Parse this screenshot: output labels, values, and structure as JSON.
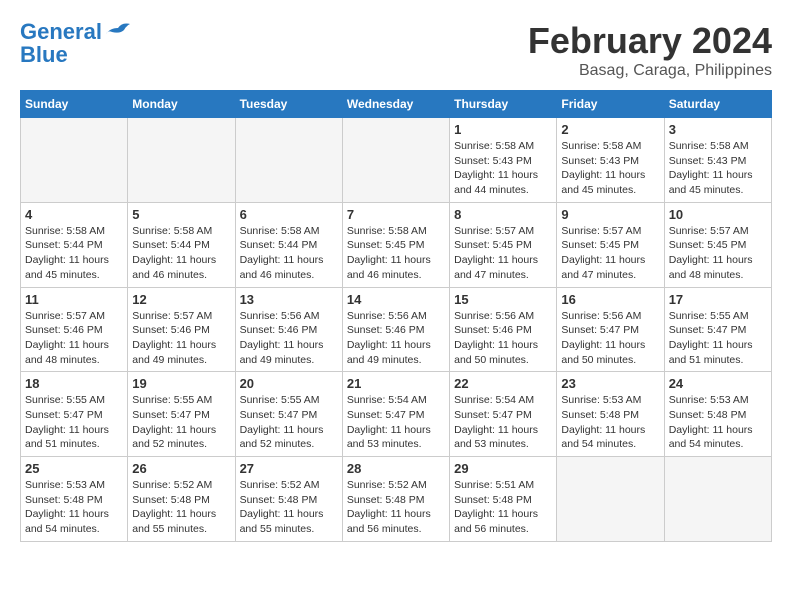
{
  "header": {
    "logo_line1": "General",
    "logo_line2": "Blue",
    "month_title": "February 2024",
    "location": "Basag, Caraga, Philippines"
  },
  "days_of_week": [
    "Sunday",
    "Monday",
    "Tuesday",
    "Wednesday",
    "Thursday",
    "Friday",
    "Saturday"
  ],
  "weeks": [
    [
      {
        "day": "",
        "info": ""
      },
      {
        "day": "",
        "info": ""
      },
      {
        "day": "",
        "info": ""
      },
      {
        "day": "",
        "info": ""
      },
      {
        "day": "1",
        "info": "Sunrise: 5:58 AM\nSunset: 5:43 PM\nDaylight: 11 hours\nand 44 minutes."
      },
      {
        "day": "2",
        "info": "Sunrise: 5:58 AM\nSunset: 5:43 PM\nDaylight: 11 hours\nand 45 minutes."
      },
      {
        "day": "3",
        "info": "Sunrise: 5:58 AM\nSunset: 5:43 PM\nDaylight: 11 hours\nand 45 minutes."
      }
    ],
    [
      {
        "day": "4",
        "info": "Sunrise: 5:58 AM\nSunset: 5:44 PM\nDaylight: 11 hours\nand 45 minutes."
      },
      {
        "day": "5",
        "info": "Sunrise: 5:58 AM\nSunset: 5:44 PM\nDaylight: 11 hours\nand 46 minutes."
      },
      {
        "day": "6",
        "info": "Sunrise: 5:58 AM\nSunset: 5:44 PM\nDaylight: 11 hours\nand 46 minutes."
      },
      {
        "day": "7",
        "info": "Sunrise: 5:58 AM\nSunset: 5:45 PM\nDaylight: 11 hours\nand 46 minutes."
      },
      {
        "day": "8",
        "info": "Sunrise: 5:57 AM\nSunset: 5:45 PM\nDaylight: 11 hours\nand 47 minutes."
      },
      {
        "day": "9",
        "info": "Sunrise: 5:57 AM\nSunset: 5:45 PM\nDaylight: 11 hours\nand 47 minutes."
      },
      {
        "day": "10",
        "info": "Sunrise: 5:57 AM\nSunset: 5:45 PM\nDaylight: 11 hours\nand 48 minutes."
      }
    ],
    [
      {
        "day": "11",
        "info": "Sunrise: 5:57 AM\nSunset: 5:46 PM\nDaylight: 11 hours\nand 48 minutes."
      },
      {
        "day": "12",
        "info": "Sunrise: 5:57 AM\nSunset: 5:46 PM\nDaylight: 11 hours\nand 49 minutes."
      },
      {
        "day": "13",
        "info": "Sunrise: 5:56 AM\nSunset: 5:46 PM\nDaylight: 11 hours\nand 49 minutes."
      },
      {
        "day": "14",
        "info": "Sunrise: 5:56 AM\nSunset: 5:46 PM\nDaylight: 11 hours\nand 49 minutes."
      },
      {
        "day": "15",
        "info": "Sunrise: 5:56 AM\nSunset: 5:46 PM\nDaylight: 11 hours\nand 50 minutes."
      },
      {
        "day": "16",
        "info": "Sunrise: 5:56 AM\nSunset: 5:47 PM\nDaylight: 11 hours\nand 50 minutes."
      },
      {
        "day": "17",
        "info": "Sunrise: 5:55 AM\nSunset: 5:47 PM\nDaylight: 11 hours\nand 51 minutes."
      }
    ],
    [
      {
        "day": "18",
        "info": "Sunrise: 5:55 AM\nSunset: 5:47 PM\nDaylight: 11 hours\nand 51 minutes."
      },
      {
        "day": "19",
        "info": "Sunrise: 5:55 AM\nSunset: 5:47 PM\nDaylight: 11 hours\nand 52 minutes."
      },
      {
        "day": "20",
        "info": "Sunrise: 5:55 AM\nSunset: 5:47 PM\nDaylight: 11 hours\nand 52 minutes."
      },
      {
        "day": "21",
        "info": "Sunrise: 5:54 AM\nSunset: 5:47 PM\nDaylight: 11 hours\nand 53 minutes."
      },
      {
        "day": "22",
        "info": "Sunrise: 5:54 AM\nSunset: 5:47 PM\nDaylight: 11 hours\nand 53 minutes."
      },
      {
        "day": "23",
        "info": "Sunrise: 5:53 AM\nSunset: 5:48 PM\nDaylight: 11 hours\nand 54 minutes."
      },
      {
        "day": "24",
        "info": "Sunrise: 5:53 AM\nSunset: 5:48 PM\nDaylight: 11 hours\nand 54 minutes."
      }
    ],
    [
      {
        "day": "25",
        "info": "Sunrise: 5:53 AM\nSunset: 5:48 PM\nDaylight: 11 hours\nand 54 minutes."
      },
      {
        "day": "26",
        "info": "Sunrise: 5:52 AM\nSunset: 5:48 PM\nDaylight: 11 hours\nand 55 minutes."
      },
      {
        "day": "27",
        "info": "Sunrise: 5:52 AM\nSunset: 5:48 PM\nDaylight: 11 hours\nand 55 minutes."
      },
      {
        "day": "28",
        "info": "Sunrise: 5:52 AM\nSunset: 5:48 PM\nDaylight: 11 hours\nand 56 minutes."
      },
      {
        "day": "29",
        "info": "Sunrise: 5:51 AM\nSunset: 5:48 PM\nDaylight: 11 hours\nand 56 minutes."
      },
      {
        "day": "",
        "info": ""
      },
      {
        "day": "",
        "info": ""
      }
    ]
  ]
}
